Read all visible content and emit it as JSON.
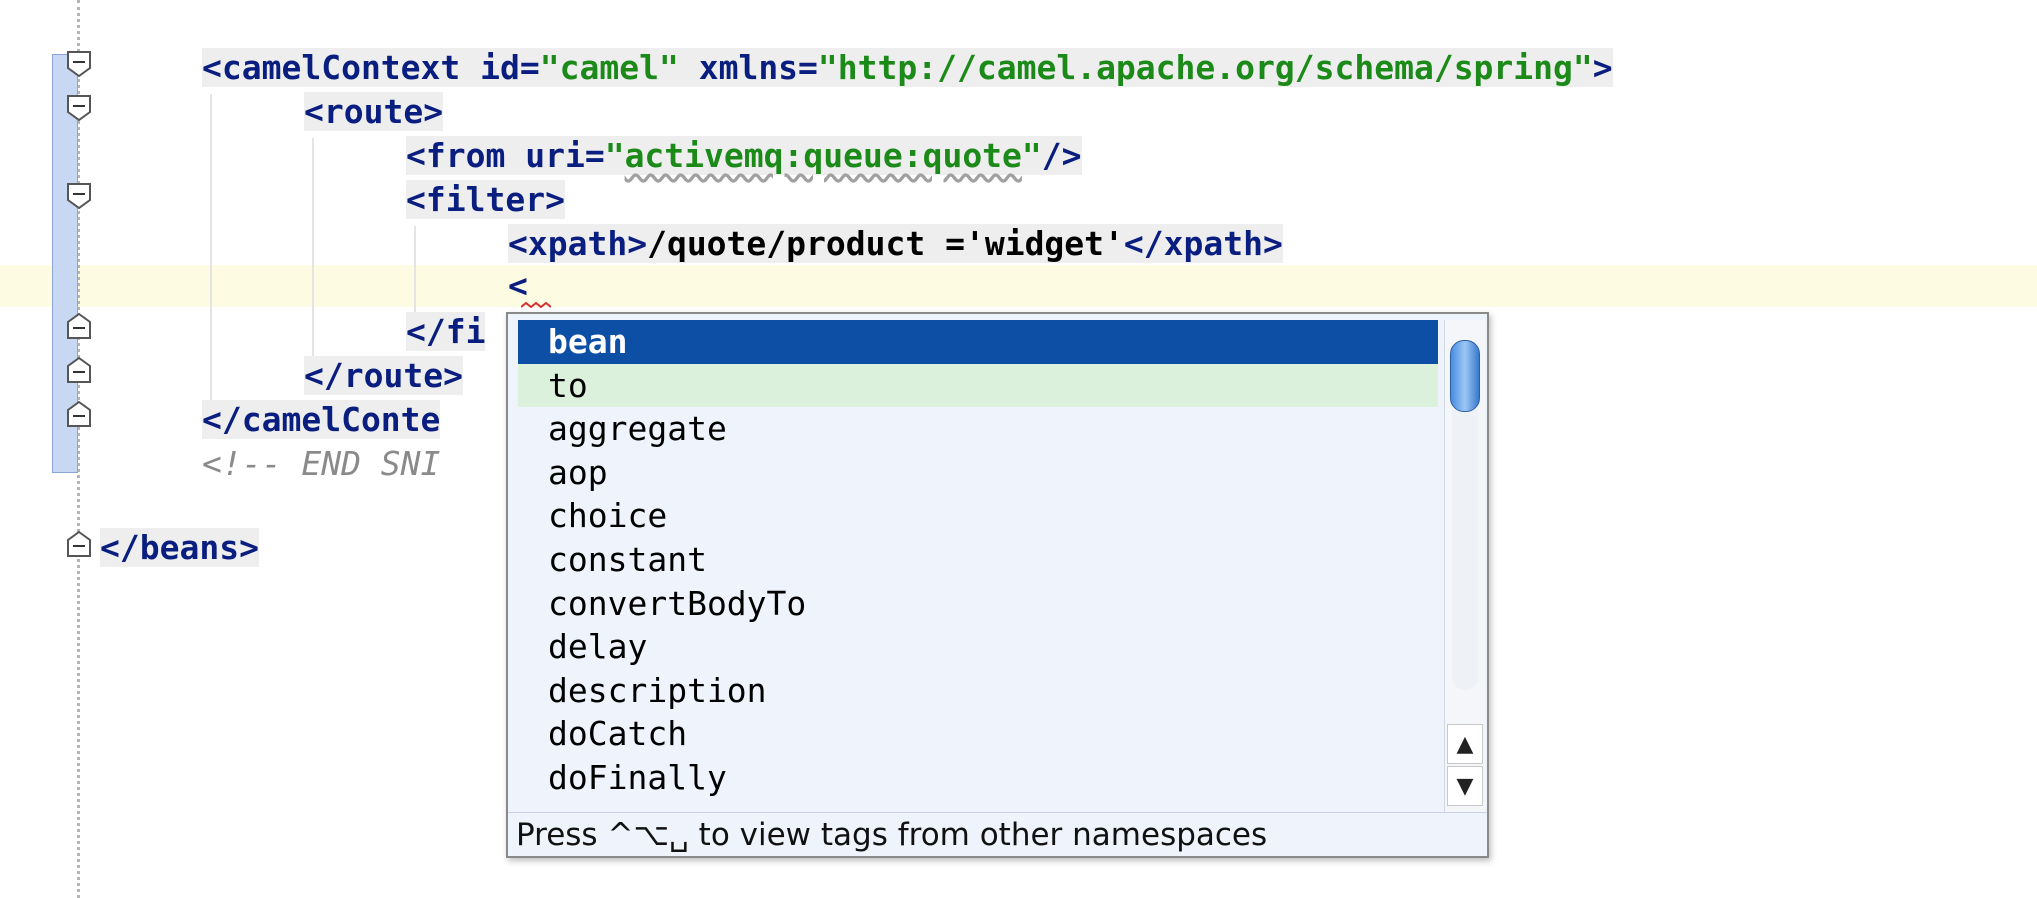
{
  "editor": {
    "lines": {
      "camel_context": {
        "tag_open": "<camelContext",
        "attr1": " id=",
        "val1": "\"camel\"",
        "attr2": " xmlns=",
        "val2": "\"http://camel.apache.org/schema/spring\"",
        "close": ">"
      },
      "route_open": "<route>",
      "from": {
        "tag_open": "<from",
        "attr": " uri=",
        "quote1": "\"",
        "val": "activemq:queue:quote",
        "quote2": "\"",
        "close": "/>"
      },
      "filter_open": "<filter>",
      "xpath": {
        "open": "<xpath>",
        "text": "/quote/product ='widget'",
        "close": "</xpath>"
      },
      "cursor_line": "<",
      "filter_close_partial": "</fi",
      "route_close": "</route>",
      "camel_close_partial": "</camelConte",
      "comment_partial": "<!-- END SNI",
      "beans_close": "</beans>"
    }
  },
  "completion": {
    "items": [
      "bean",
      "to",
      "aggregate",
      "aop",
      "choice",
      "constant",
      "convertBodyTo",
      "delay",
      "description",
      "doCatch",
      "doFinally"
    ],
    "selected_index": 0,
    "hover_index": 1,
    "footer": "Press ^⌥␣ to view tags from other namespaces",
    "scroll_up": "▲",
    "scroll_down": "▼"
  },
  "colors": {
    "tag": "#0a1e80",
    "attribute_value": "#1b8a19",
    "comment": "#8a8a8a",
    "selection": "#0e4fa6",
    "current_line": "#fdfbe2"
  }
}
